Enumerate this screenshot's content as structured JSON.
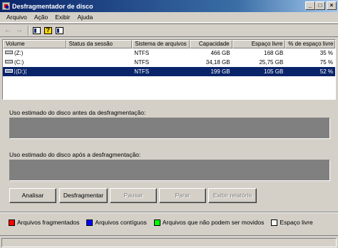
{
  "window": {
    "title": "Desfragmentador de disco",
    "controls": {
      "minimize": "_",
      "maximize": "□",
      "close": "×"
    }
  },
  "menu": [
    "Arquivo",
    "Ação",
    "Exibir",
    "Ajuda"
  ],
  "toolbar": {
    "icons": [
      "back-arrow-icon",
      "forward-arrow-icon",
      "properties-icon",
      "help-icon",
      "export-list-icon"
    ]
  },
  "volumes": {
    "columns": [
      "Volume",
      "Status da sessão",
      "Sistema de arquivos",
      "Capacidade",
      "Espaço livre",
      "% de espaço livre"
    ],
    "rows": [
      {
        "volume": "(Z:)",
        "status": "",
        "fs": "NTFS",
        "capacity": "466 GB",
        "free": "168 GB",
        "pct": "35 %"
      },
      {
        "volume": "(C:)",
        "status": "",
        "fs": "NTFS",
        "capacity": "34,18 GB",
        "free": "25,75 GB",
        "pct": "75 %"
      },
      {
        "volume": "(D:)",
        "status": "",
        "fs": "NTFS",
        "capacity": "199 GB",
        "free": "105 GB",
        "pct": "52 %"
      }
    ],
    "selected_index": 2
  },
  "analysis": {
    "before_label": "Uso estimado do disco antes da desfragmentação:",
    "after_label": "Uso estimado do disco após a desfragmentação:",
    "bar_color": "#808080"
  },
  "buttons": {
    "analyze": "Analisar",
    "defragment": "Desfragmentar",
    "pause": "Pausar",
    "stop": "Parar",
    "report": "Exibir relatório"
  },
  "legend": [
    {
      "label": "Arquivos fragmentados",
      "color": "#ff0000"
    },
    {
      "label": "Arquivos contíguos",
      "color": "#0000ff"
    },
    {
      "label": "Arquivos que não podem ser movidos",
      "color": "#00ff00"
    },
    {
      "label": "Espaço livre",
      "color": "#ffffff"
    }
  ]
}
